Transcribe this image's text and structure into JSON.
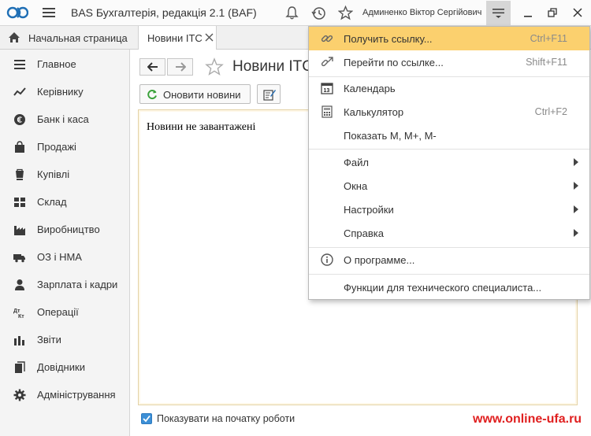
{
  "window": {
    "app_title": "BAS Бухгалтерія, редакція 2.1  (BAF)",
    "user_name": "Админенко Віктор Сергійович"
  },
  "tabs": {
    "home_label": "Начальная страница",
    "news_label": "Новини ІТС"
  },
  "sidebar": {
    "items": [
      {
        "label": "Главное",
        "icon": "list-icon"
      },
      {
        "label": "Керівнику",
        "icon": "trend-icon"
      },
      {
        "label": "Банк і каса",
        "icon": "coin-icon"
      },
      {
        "label": "Продажі",
        "icon": "bag-icon"
      },
      {
        "label": "Купівлі",
        "icon": "cart-icon"
      },
      {
        "label": "Склад",
        "icon": "grid-icon"
      },
      {
        "label": "Виробництво",
        "icon": "factory-icon"
      },
      {
        "label": "ОЗ і НМА",
        "icon": "truck-icon"
      },
      {
        "label": "Зарплата і кадри",
        "icon": "person-icon"
      },
      {
        "label": "Операції",
        "icon": "dt-kt-icon"
      },
      {
        "label": "Звіти",
        "icon": "bar-chart-icon"
      },
      {
        "label": "Довідники",
        "icon": "books-icon"
      },
      {
        "label": "Адміністрування",
        "icon": "gear-icon"
      }
    ]
  },
  "content": {
    "page_title": "Новини ІТС",
    "refresh_label": "Оновити новини",
    "news_text": "Новини не завантажені",
    "show_at_start_label": "Показувати на початку роботи",
    "show_at_start_checked": true,
    "watermark": "www.online-ufa.ru"
  },
  "menu": {
    "items": [
      {
        "label": "Получить ссылку...",
        "shortcut": "Ctrl+F11",
        "icon": "link-icon",
        "highlighted": true
      },
      {
        "label": "Перейти по ссылке...",
        "shortcut": "Shift+F11",
        "icon": "goto-link-icon"
      },
      {
        "label": "Календарь",
        "shortcut": "",
        "icon": "calendar-icon"
      },
      {
        "label": "Калькулятор",
        "shortcut": "Ctrl+F2",
        "icon": "calculator-icon"
      },
      {
        "label": "Показать М, М+, М-",
        "shortcut": ""
      },
      {
        "label": "Файл",
        "submenu": true
      },
      {
        "label": "Окна",
        "submenu": true
      },
      {
        "label": "Настройки",
        "submenu": true
      },
      {
        "label": "Справка",
        "submenu": true
      },
      {
        "label": "О программе...",
        "icon": "info-icon"
      },
      {
        "label": "Функции для технического специалиста..."
      }
    ],
    "highlight_color": "#fbd06e"
  }
}
